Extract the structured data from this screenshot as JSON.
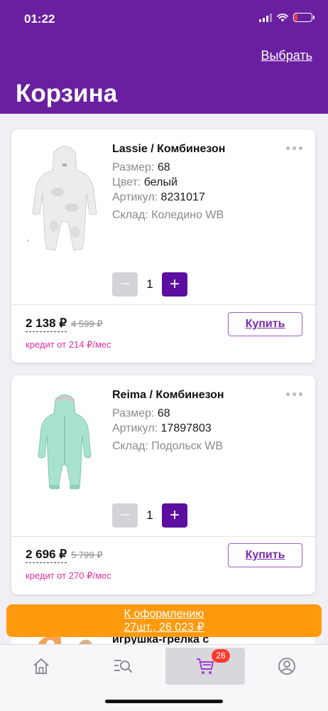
{
  "status_bar": {
    "time": "01:22"
  },
  "header": {
    "select_label": "Выбрать",
    "title": "Корзина"
  },
  "cart_items": [
    {
      "name": "Lassie / Комбинезон",
      "size_label": "Размер:",
      "size": "68",
      "color_label": "Цвет:",
      "color": "белый",
      "article_label": "Артикул:",
      "article": "8231017",
      "warehouse_label": "Склад:",
      "warehouse": "Коледино WB",
      "quantity": "1",
      "price": "2 138 ₽",
      "old_price": "4 599 ₽",
      "credit": "кредит от 214 ₽/мес",
      "buy_label": "Купить"
    },
    {
      "name": "Reima / Комбинезон",
      "size_label": "Размер:",
      "size": "68",
      "article_label": "Артикул:",
      "article": "17897803",
      "warehouse_label": "Склад:",
      "warehouse": "Подольск WB",
      "quantity": "1",
      "price": "2 696 ₽",
      "old_price": "5 799 ₽",
      "credit": "кредит от 270 ₽/мес",
      "buy_label": "Купить"
    },
    {
      "name": "игрушка-грелка с"
    }
  ],
  "checkout": {
    "line1": "К оформлению",
    "line2": "27шт., 26 023 ₽"
  },
  "tabbar": {
    "cart_badge": "26",
    "icons": [
      "home-icon",
      "catalog-search-icon",
      "cart-icon",
      "profile-icon"
    ]
  },
  "colors": {
    "brand": "#6a1fa0",
    "accent": "#5b0ea0",
    "checkout": "#ff9a0f",
    "credit": "#e0339d",
    "badge": "#ff3b30"
  }
}
